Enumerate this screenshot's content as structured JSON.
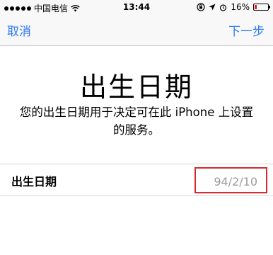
{
  "status_bar": {
    "carrier": "中国电信",
    "network_icon": "wifi-icon",
    "time": "13:44",
    "battery_percent": "16%",
    "battery_level": 0.16,
    "battery_color": "#e0211d"
  },
  "nav": {
    "cancel_label": "取消",
    "next_label": "下一步",
    "accent_color": "#2f7cf6"
  },
  "main": {
    "title": "出生日期",
    "description_line1": "您的出生日期用于决定可在此 iPhone 上设置",
    "description_line2": "的服务。"
  },
  "birthday_row": {
    "label": "出生日期",
    "value": "94/2/10",
    "highlight_color": "#d62b2f"
  }
}
